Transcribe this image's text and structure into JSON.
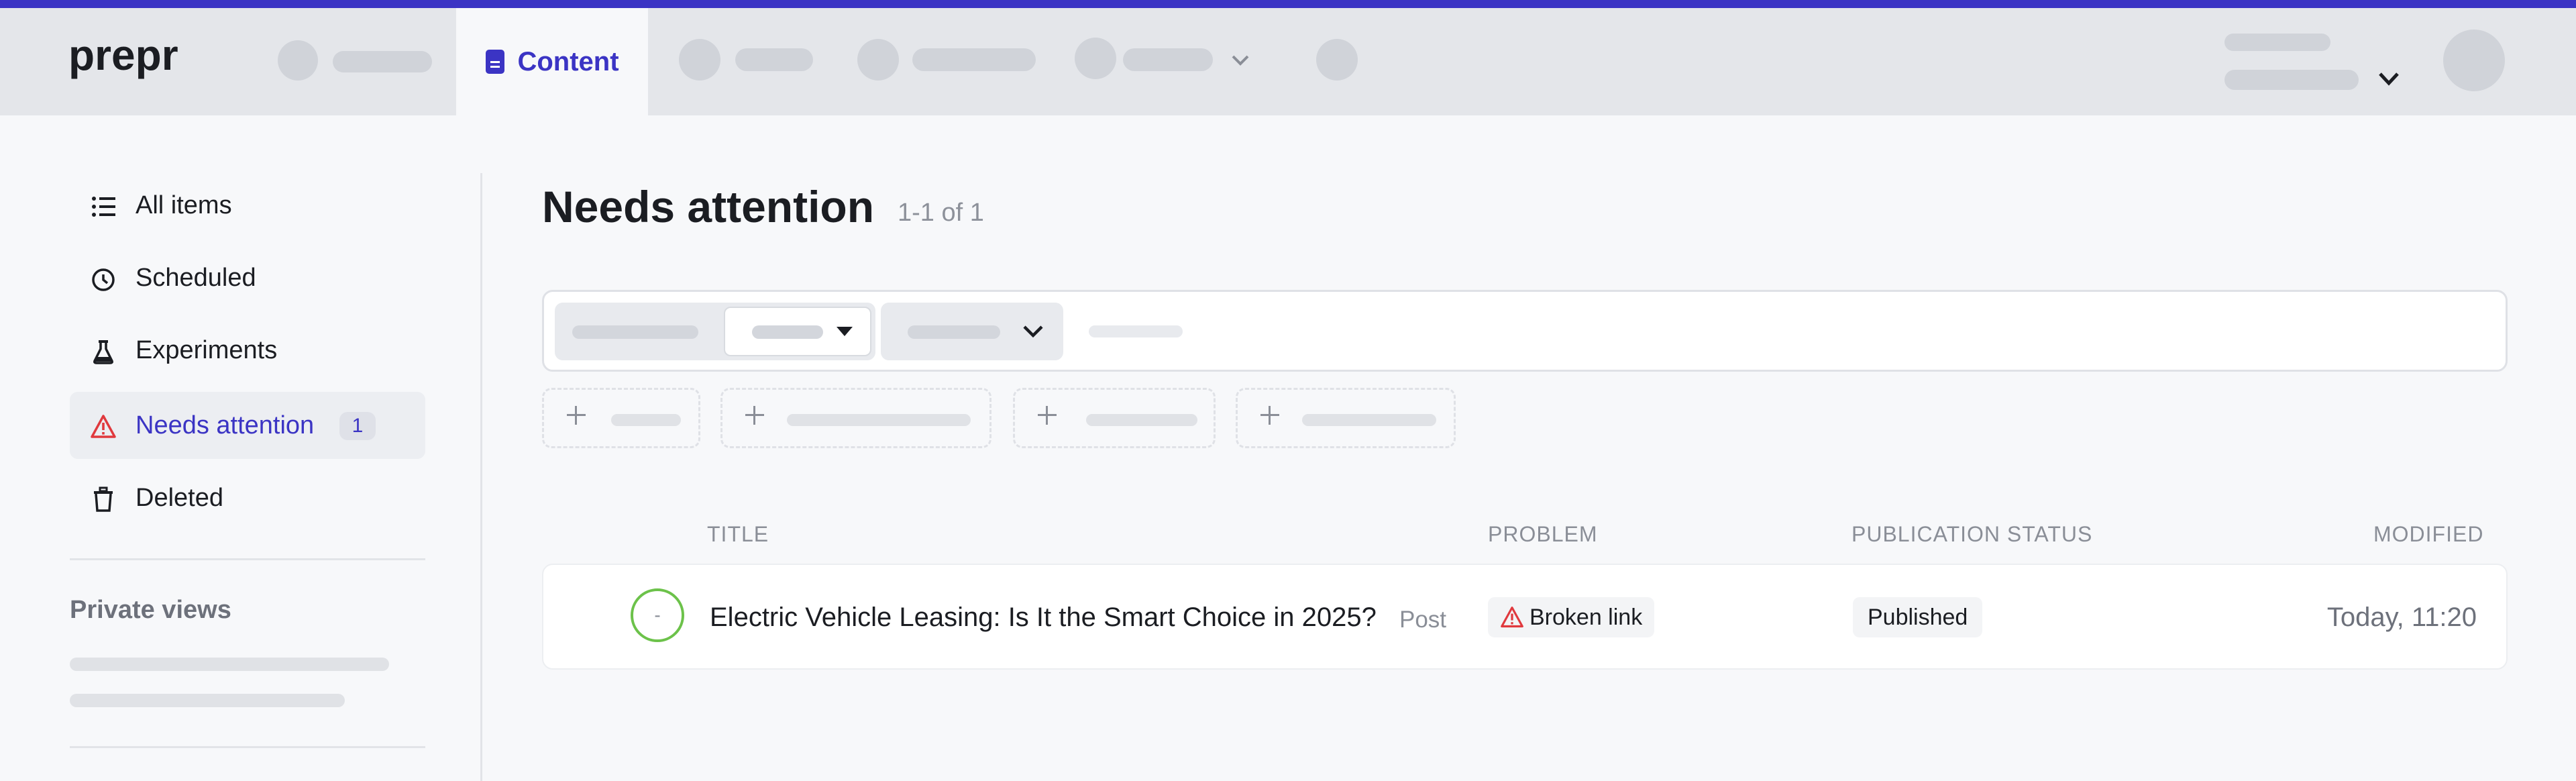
{
  "app": {
    "logo_text": "prepr"
  },
  "nav": {
    "active_tab_label": "Content"
  },
  "sidebar": {
    "items": [
      {
        "label": "All items",
        "icon": "list-icon"
      },
      {
        "label": "Scheduled",
        "icon": "clock-icon"
      },
      {
        "label": "Experiments",
        "icon": "flask-icon"
      },
      {
        "label": "Needs attention",
        "icon": "warning-icon",
        "count": "1",
        "active": true
      },
      {
        "label": "Deleted",
        "icon": "trash-icon"
      }
    ],
    "private_views_title": "Private views"
  },
  "main": {
    "title": "Needs attention",
    "count_text": "1-1 of 1",
    "table": {
      "columns": [
        "TITLE",
        "PROBLEM",
        "PUBLICATION STATUS",
        "MODIFIED"
      ],
      "rows": [
        {
          "status_symbol": "-",
          "title": "Electric Vehicle Leasing: Is It the Smart Choice in 2025?",
          "type": "Post",
          "problem": "Broken link",
          "publication_status": "Published",
          "modified": "Today, 11:20"
        }
      ]
    }
  },
  "colors": {
    "accent": "#3b34c4",
    "warning": "#e0393e",
    "status_ring": "#6cc24a"
  }
}
